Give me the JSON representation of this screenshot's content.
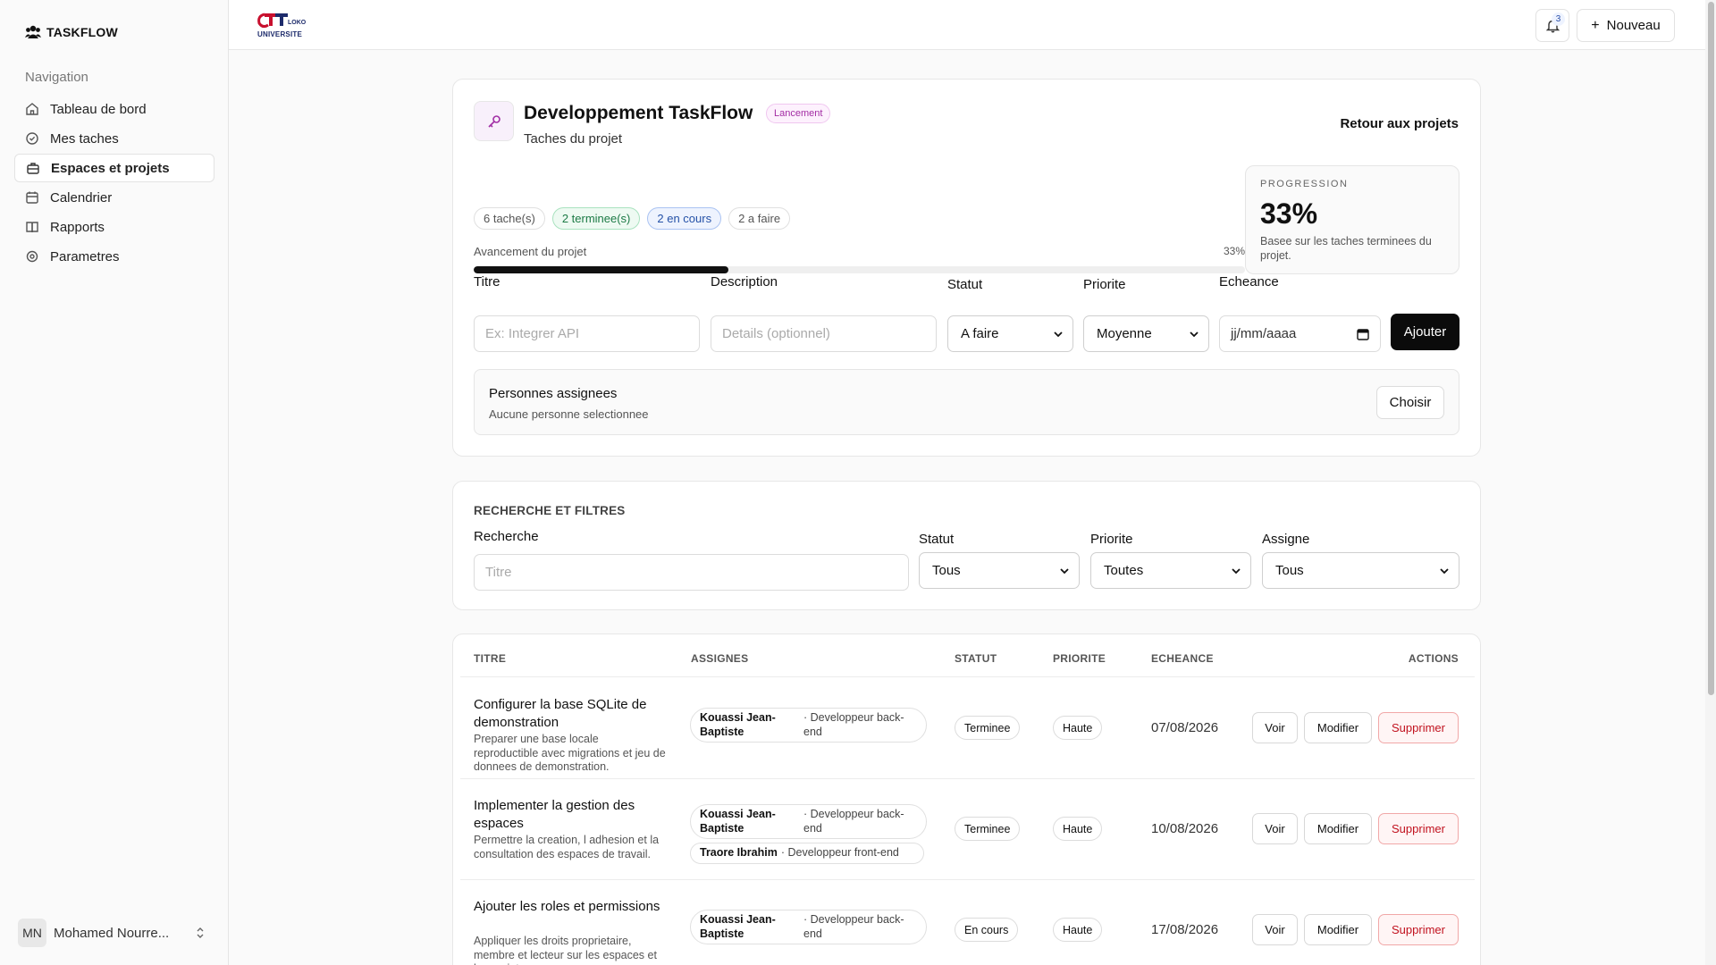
{
  "app": {
    "brand": "TASKFLOW",
    "logo_text": [
      "LOKO",
      "UNIVERSITE"
    ]
  },
  "sidebar": {
    "heading": "Navigation",
    "items": [
      {
        "label": "Tableau de bord",
        "icon": "home-icon"
      },
      {
        "label": "Mes taches",
        "icon": "check-circle-icon"
      },
      {
        "label": "Espaces et projets",
        "icon": "briefcase-icon",
        "active": true
      },
      {
        "label": "Calendrier",
        "icon": "calendar-icon"
      },
      {
        "label": "Rapports",
        "icon": "book-icon"
      },
      {
        "label": "Parametres",
        "icon": "settings-icon"
      }
    ],
    "user": {
      "initials": "MN",
      "name": "Mohamed Nourre..."
    }
  },
  "topbar": {
    "notifications_count": "3",
    "new_label": "Nouveau"
  },
  "project": {
    "title": "Developpement TaskFlow",
    "badge": "Lancement",
    "subtitle": "Taches du projet",
    "back_link": "Retour aux projets",
    "chips": {
      "total": "6 tache(s)",
      "done": "2 terminee(s)",
      "in_progress": "2 en cours",
      "todo": "2 a faire"
    },
    "progress_label": "Avancement du projet",
    "progress_pct_text": "33%",
    "progress_value": 0.33,
    "progress_box": {
      "label": "PROGRESSION",
      "value": "33%",
      "description": "Basee sur les taches terminees du projet."
    }
  },
  "task_form": {
    "title_label": "Titre",
    "title_placeholder": "Ex: Integrer API",
    "desc_label": "Description",
    "desc_placeholder": "Details (optionnel)",
    "status_label": "Statut",
    "status_value": "A faire",
    "priority_label": "Priorite",
    "priority_value": "Moyenne",
    "due_label": "Echeance",
    "due_placeholder": "jj/mm/aaaa",
    "submit_label": "Ajouter",
    "assign_title": "Personnes assignees",
    "assign_sub": "Aucune personne selectionnee",
    "choose_label": "Choisir"
  },
  "filters": {
    "heading": "RECHERCHE ET FILTRES",
    "search_label": "Recherche",
    "search_placeholder": "Titre",
    "status_label": "Statut",
    "status_value": "Tous",
    "priority_label": "Priorite",
    "priority_value": "Toutes",
    "assignee_label": "Assigne",
    "assignee_value": "Tous"
  },
  "table": {
    "headers": {
      "title": "TITRE",
      "assignees": "ASSIGNES",
      "status": "STATUT",
      "priority": "PRIORITE",
      "due": "ECHEANCE",
      "actions": "ACTIONS"
    },
    "action_labels": {
      "view": "Voir",
      "edit": "Modifier",
      "delete": "Supprimer"
    },
    "rows": [
      {
        "title": "Configurer la base SQLite de demonstration",
        "description": "Preparer une base locale reproductible avec migrations et jeu de donnees de demonstration.",
        "assignees": [
          {
            "name": "Kouassi Jean-Baptiste",
            "role": "· Developpeur back-end"
          }
        ],
        "status": "Terminee",
        "priority": "Haute",
        "due": "07/08/2026"
      },
      {
        "title": "Implementer la gestion des espaces",
        "description": "Permettre la creation, l adhesion et la consultation des espaces de travail.",
        "assignees": [
          {
            "name": "Kouassi Jean-Baptiste",
            "role": "· Developpeur back-end"
          },
          {
            "name": "Traore Ibrahim",
            "role": "· Developpeur front-end"
          }
        ],
        "status": "Terminee",
        "priority": "Haute",
        "due": "10/08/2026"
      },
      {
        "title": "Ajouter les roles et permissions",
        "description": "Appliquer les droits proprietaire, membre et lecteur sur les espaces et les projets.",
        "assignees": [
          {
            "name": "Kouassi Jean-Baptiste",
            "role": "· Developpeur back-end"
          }
        ],
        "status": "En cours",
        "priority": "Haute",
        "due": "17/08/2026"
      }
    ]
  }
}
